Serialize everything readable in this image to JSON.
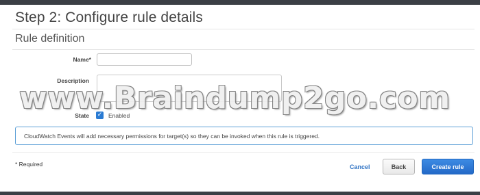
{
  "page": {
    "title": "Step 2: Configure rule details",
    "section_title": "Rule definition"
  },
  "form": {
    "name_label": "Name*",
    "name_value": "",
    "description_label": "Description",
    "description_value": "",
    "state_label": "State",
    "state_checkbox_checked": true,
    "state_checkbox_label": "Enabled"
  },
  "info": {
    "text": "CloudWatch Events will add necessary permissions for target(s) so they can be invoked when this rule is triggered."
  },
  "footer": {
    "required_note": "* Required",
    "cancel_label": "Cancel",
    "back_label": "Back",
    "create_label": "Create rule"
  },
  "watermark": {
    "text": "www.Braindump2go.com"
  },
  "colors": {
    "primary_button": "#2a6fcb",
    "link": "#2e72c4",
    "info_border": "#5a9ed6",
    "checkbox": "#2a7bd3"
  }
}
